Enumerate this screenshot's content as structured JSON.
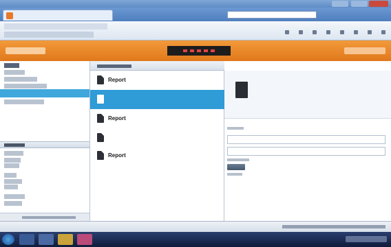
{
  "browser": {
    "window_title": "",
    "tab_title": "",
    "address": ""
  },
  "app": {
    "brand": "",
    "header_center": "",
    "header_right": ""
  },
  "list_pane": {
    "items": [
      {
        "label": "Report"
      },
      {
        "label": ""
      },
      {
        "label": "Report"
      },
      {
        "label": ""
      },
      {
        "label": "Report"
      }
    ]
  },
  "detail": {
    "title_label": "",
    "title_value": "",
    "type_label": "",
    "type_value": ""
  },
  "colors": {
    "accent_orange": "#e8821f",
    "selection_blue": "#2f9bd7",
    "header_dark": "#1d1d1d"
  }
}
